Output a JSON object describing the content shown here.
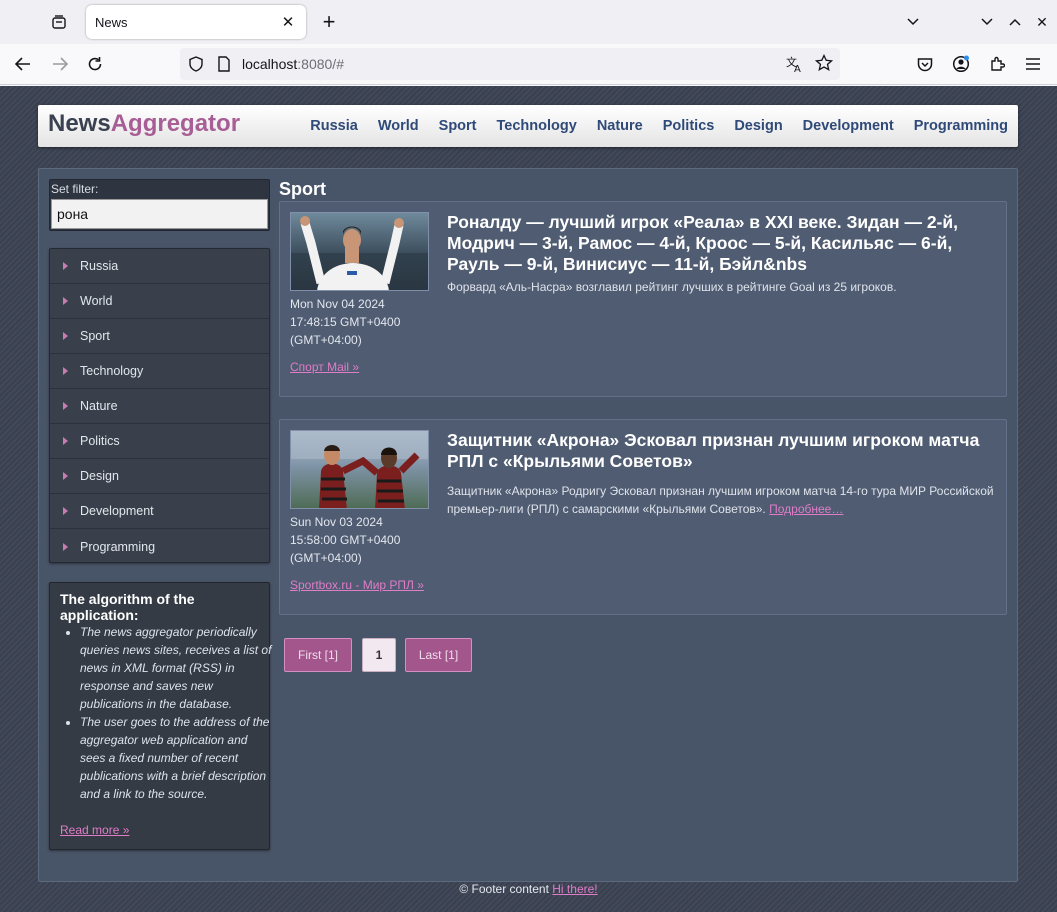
{
  "browser": {
    "tab_title": "News",
    "url_host": "localhost",
    "url_rest": ":8080/#"
  },
  "header": {
    "logo_part1": "News",
    "logo_part2": "Aggregator",
    "menu": [
      "Russia",
      "World",
      "Sport",
      "Technology",
      "Nature",
      "Politics",
      "Design",
      "Development",
      "Programming"
    ]
  },
  "sidebar": {
    "filter_label": "Set filter:",
    "filter_value": "рона",
    "items": [
      "Russia",
      "World",
      "Sport",
      "Technology",
      "Nature",
      "Politics",
      "Design",
      "Development",
      "Programming"
    ],
    "algorithm": {
      "title": "The algorithm of the application:",
      "points": [
        "The news aggregator periodically queries news sites, receives a list of news in XML format (RSS) in response and saves new publications in the database.",
        "The user goes to the address of the aggregator web application and sees a fixed number of recent publications with a brief description and a link to the source."
      ],
      "read_more": "Read more »"
    }
  },
  "main": {
    "category_title": "Sport",
    "news": [
      {
        "title": "Роналду — лучший игрок «Реала» в XXI веке. Зидан — 2-й, Модрич — 3-й, Рамос — 4-й, Кроос — 5-й, Касильяс — 6-й, Рауль — 9-й, Винисиус — 11-й, Бэйл&nbs",
        "description": "Форвард «Аль-Насра» возглавил рейтинг лучших в рейтинге Goal из 25 игроков.",
        "more": "",
        "date": "Mon Nov 04 2024 17:48:15 GMT+0400 (GMT+04:00)",
        "source": "Спорт Mail »"
      },
      {
        "title": "Защитник «Акрона» Эсковал признан лучшим игроком матча РПЛ с «Крыльями Советов»",
        "description": "Защитник «Акрона» Родригу Эсковал признан лучшим игроком матча 14-го тура МИР Российской премьер-лиги (РПЛ) с самарскими «Крыльями Советов».",
        "more": "Подробнее…",
        "date": "Sun Nov 03 2024 15:58:00 GMT+0400 (GMT+04:00)",
        "source": "Sportbox.ru - Мир РПЛ »"
      }
    ],
    "pagination": {
      "first": "First [1]",
      "current": "1",
      "last": "Last [1]"
    }
  },
  "footer": {
    "text": "© Footer content",
    "link": "Hi there!"
  }
}
